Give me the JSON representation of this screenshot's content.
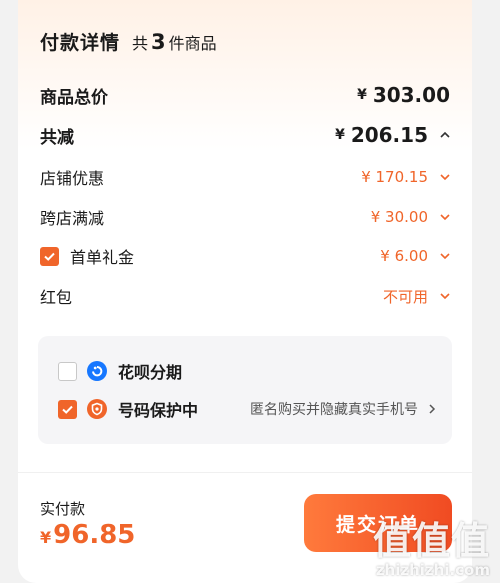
{
  "header": {
    "title": "付款详情",
    "count_prefix": "共",
    "count": "3",
    "count_suffix": "件商品"
  },
  "rows": {
    "total": {
      "label": "商品总价",
      "currency": "¥",
      "amount": "303.00"
    },
    "discount": {
      "label": "共减",
      "currency": "¥",
      "amount": "206.15"
    },
    "store_discount": {
      "label": "店铺优惠",
      "amount": "¥ 170.15"
    },
    "cross_store": {
      "label": "跨店满减",
      "amount": "¥ 30.00"
    },
    "first_order": {
      "label": "首单礼金",
      "amount": "¥ 6.00",
      "checked": true
    },
    "red_packet": {
      "label": "红包",
      "status": "不可用"
    }
  },
  "options": {
    "installment": {
      "label": "花呗分期",
      "checked": false,
      "icon": "huabei-icon"
    },
    "number_protect": {
      "label": "号码保护中",
      "checked": true,
      "icon": "phone-shield-icon",
      "desc": "匿名购买并隐藏真实手机号"
    }
  },
  "footer": {
    "pay_label": "实付款",
    "currency": "¥",
    "amount": "96.85",
    "submit_label": "提交订单"
  },
  "watermark": {
    "small": "值",
    "site": "zhizhizhi.com",
    "big": "值值值"
  },
  "colors": {
    "accent": "#f0652a",
    "blue": "#1677ff"
  }
}
